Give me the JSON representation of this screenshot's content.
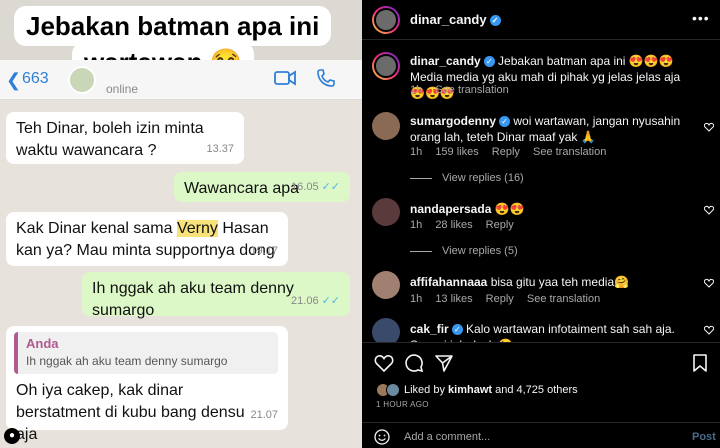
{
  "story": {
    "caption_line1": "Jebakan batman apa ini",
    "caption_line2": "wartawan 😂",
    "chat": {
      "back_count": "663",
      "status": "online",
      "messages": [
        {
          "text": "Teh Dinar, boleh izin minta waktu wawancara ?",
          "time": "13.37"
        },
        {
          "text": "Wawancara apa",
          "time": "16.05"
        },
        {
          "text_before": "Kak Dinar kenal sama ",
          "highlight": "Verny",
          "text_after": " Hasan kan ya? Mau minta supportnya dong",
          "time": "19.17"
        },
        {
          "text": "Ih nggak ah aku team denny sumargo",
          "time": "21.06"
        },
        {
          "quote_author": "Anda",
          "quote_text": "Ih nggak ah aku team denny sumargo",
          "text": "Oh iya cakep, kak dinar berstatment di kubu bang densu aja",
          "time": "21.07"
        }
      ]
    }
  },
  "instagram": {
    "post_user": "dinar_candy",
    "caption": {
      "user": "dinar_candy",
      "text1": "Jebakan batman apa ini 😍😍😍",
      "text2": "Media media yg aku mah di pihak yg jelas jelas aja 😍😍😍",
      "age": "1h",
      "see_translation": "See translation"
    },
    "comments": [
      {
        "user": "sumargodenny",
        "text": "woi wartawan, jangan nyusahin orang lah, teteh Dinar maaf yak 🙏",
        "age": "1h",
        "likes": "159 likes",
        "reply": "Reply",
        "translate": "See translation",
        "view_replies": "View replies (16)"
      },
      {
        "user": "nandapersada",
        "text": "😍😍",
        "age": "1h",
        "likes": "28 likes",
        "reply": "Reply",
        "view_replies": "View replies (5)"
      },
      {
        "user": "affifahannaaa",
        "text": "bisa gitu yaa teh media🤗",
        "age": "1h",
        "likes": "13 likes",
        "reply": "Reply",
        "translate": "See translation"
      },
      {
        "user": "cak_fir",
        "text": "Kalo wartawan infotaiment sah sah aja. Sesuai job desk 😉"
      }
    ],
    "liked_by_prefix": "Liked by ",
    "liked_by_user": "kimhawt",
    "liked_by_suffix": " and 4,725 others",
    "time_ago": "1 HOUR AGO",
    "add_comment_placeholder": "Add a comment...",
    "post_label": "Post",
    "colors": {
      "verified": "#3897f0",
      "link": "#4a6b8a",
      "wa_outgoing": "#dcf8c6"
    }
  }
}
